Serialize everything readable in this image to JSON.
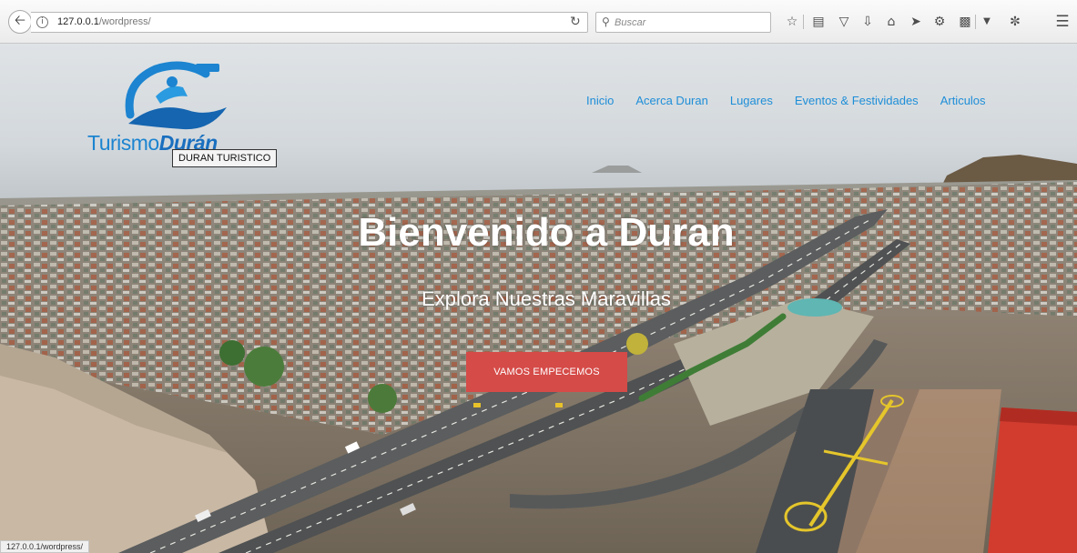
{
  "browser": {
    "url_host": "127.0.0.1",
    "url_path": "/wordpress/",
    "search_placeholder": "Buscar",
    "status_url": "127.0.0.1/wordpress/"
  },
  "site": {
    "logo_text_light": "Turismo",
    "logo_text_bold": "Durán",
    "tagline": "DURAN TURISTICO"
  },
  "nav": {
    "items": [
      {
        "label": "Inicio"
      },
      {
        "label": "Acerca Duran"
      },
      {
        "label": "Lugares"
      },
      {
        "label": "Eventos & Festividades"
      },
      {
        "label": "Articulos"
      }
    ]
  },
  "hero": {
    "title": "Bienvenido a Duran",
    "subtitle": "Explora Nuestras Maravillas",
    "cta_label": "VAMOS EMPECEMOS"
  },
  "colors": {
    "nav_link": "#1e8ed8",
    "cta_background": "#d54b48",
    "logo_blue": "#1c84d0"
  },
  "icons": [
    "back-icon",
    "info-icon",
    "reload-icon",
    "search-icon",
    "bookmark-star-icon",
    "reading-list-icon",
    "pocket-icon",
    "download-icon",
    "home-icon",
    "send-icon",
    "extension-icon",
    "clipboard-icon",
    "dropdown-icon",
    "puzzle-icon",
    "menu-icon"
  ]
}
